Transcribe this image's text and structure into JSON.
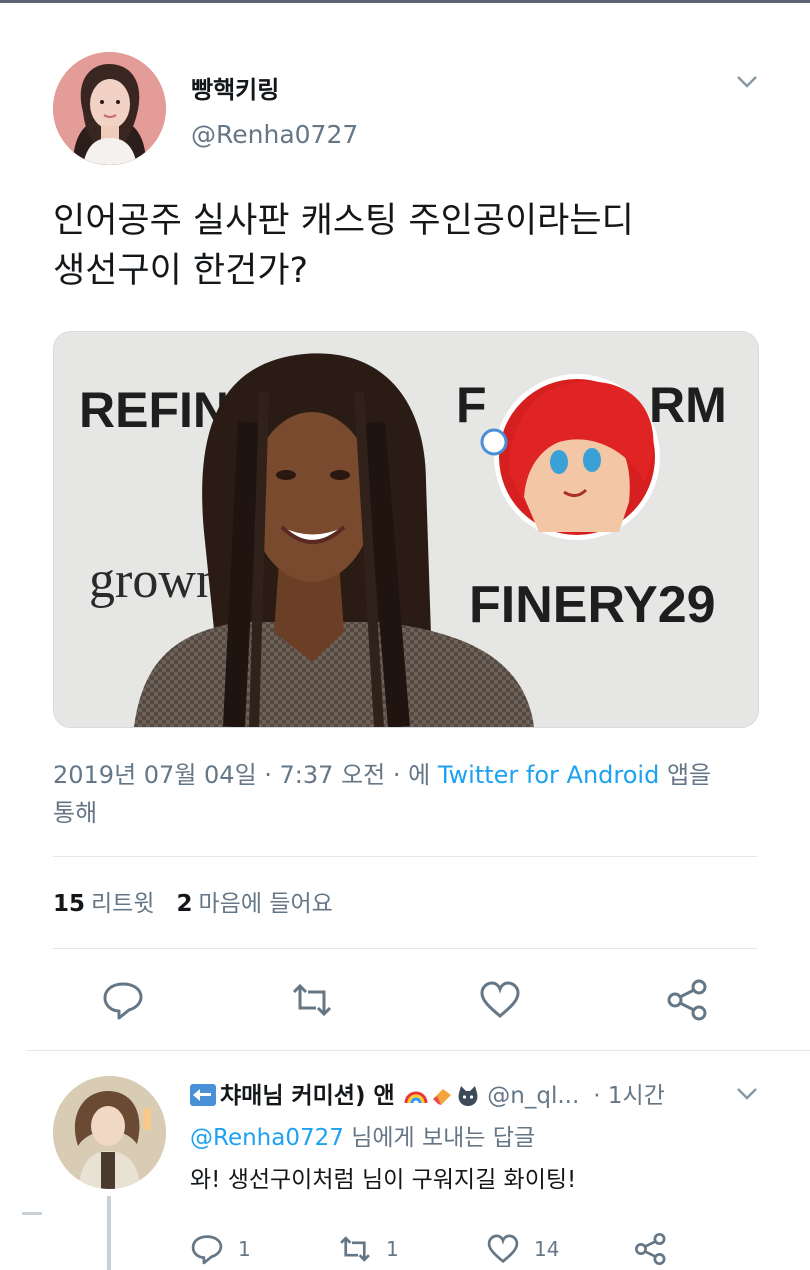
{
  "tweet": {
    "display_name": "빵핵키링",
    "handle": "@Renha0727",
    "text_line1": "인어공주 실사판 캐스팅 주인공이라는디",
    "text_line2": "생선구이 한건가?",
    "media": {
      "sign_left_top": "REFINE",
      "sign_right_top_a": "F",
      "sign_right_top_b": "RM",
      "sign_left_bottom": "grown",
      "sign_right_bottom": "FINERY29"
    },
    "timestamp": "2019년 07월 04일 · 7:37 오전 · 에",
    "source_link": "Twitter for Android",
    "source_suffix_1": "앱을",
    "source_suffix_2": "통해",
    "retweet_count": "15",
    "retweet_label": "리트윗",
    "like_count": "2",
    "like_label": "마음에 들어요",
    "actions": [
      "reply-icon",
      "retweet-icon",
      "heart-icon",
      "share-icon"
    ]
  },
  "reply": {
    "display_name": "챠매님 커미션) 앤",
    "handle": "@n_ql...",
    "time": "· 1시간",
    "replying_to_handle": "@Renha0727",
    "replying_to_suffix": "님에게 보내는 답글",
    "text": "와! 생선구이처럼 님이 구워지길 화이팅!",
    "reply_count": "1",
    "retweet_count": "1",
    "like_count": "14"
  },
  "colors": {
    "link": "#1da1f2",
    "secondary_text": "#657786",
    "divider": "#e1e8ed"
  }
}
